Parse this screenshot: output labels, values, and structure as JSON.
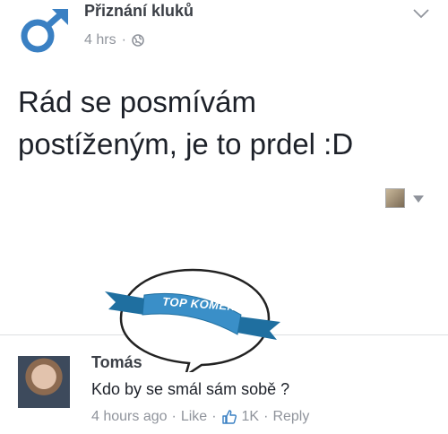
{
  "post": {
    "page_name": "Přiznání kluků",
    "time": "4 hrs",
    "dot": "·",
    "text": "Rád se posmívám postíženým, je to prdel :D",
    "privacy_icon": "globe-icon",
    "page_icon": "male-symbol-icon"
  },
  "badge": {
    "label": "TOP KOMENTY"
  },
  "comment": {
    "author": "Tomás",
    "text": "Kdo by se smál sám sobě ?",
    "time": "4 hours ago",
    "dot1": "·",
    "like": "Like",
    "dot2": "·",
    "likes_count": "1K",
    "dot3": "·",
    "reply": "Reply"
  },
  "colors": {
    "brand": "#3a80c3",
    "meta_gray": "#90949c",
    "text": "#1d2129"
  }
}
